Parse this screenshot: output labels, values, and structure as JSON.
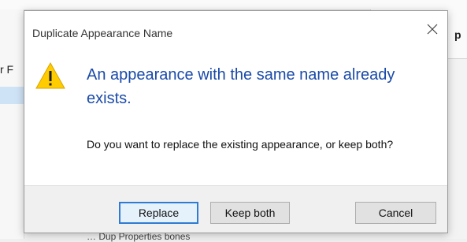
{
  "background": {
    "left_text": "r F",
    "right_text": "p",
    "bottom_text": "… Dup Properties  bones"
  },
  "dialog": {
    "title": "Duplicate Appearance Name",
    "main_instruction": "An appearance with the same name already exists.",
    "content": "Do you want to replace the existing appearance, or keep both?",
    "buttons": {
      "replace": "Replace",
      "keep_both": "Keep both",
      "cancel": "Cancel"
    },
    "icons": {
      "warning": "warning-icon",
      "close": "close-icon"
    }
  },
  "colors": {
    "main_instruction": "#1a4aa8",
    "warning_fill": "#ffcc00",
    "default_button_border": "#2f7bd1"
  }
}
